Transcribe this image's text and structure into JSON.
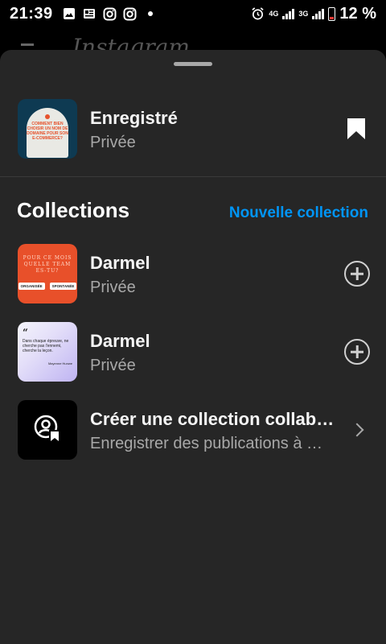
{
  "status_bar": {
    "time": "21:39",
    "left_icons": [
      "image-icon",
      "news-icon",
      "instagram-icon",
      "instagram-icon",
      "dot-icon"
    ],
    "network_4g": "4G",
    "network_3g": "3G",
    "battery_percent": "12 %"
  },
  "background_app": {
    "logo": "Instagram"
  },
  "saved": {
    "title": "Enregistré",
    "subtitle": "Privée",
    "thumb_text": "COMMENT BIEN CHOISIR UN NOM DE DOMAINE POUR SON E-COMMERCE?",
    "icon": "bookmark-icon"
  },
  "collections": {
    "heading": "Collections",
    "new_collection_label": "Nouvelle collection",
    "items": [
      {
        "title": "Darmel",
        "subtitle": "Privée",
        "thumb_title": "POUR CE MOIS QUELLE TEAM ES-TU?",
        "thumb_chip_1": "ORGANISÉE",
        "thumb_chip_2": "SPONTANÉE"
      },
      {
        "title": "Darmel",
        "subtitle": "Privée",
        "thumb_quote": "Dans chaque épreuve, ne cherche pas l'ennemi, cherche la leçon.",
        "thumb_author": "Mayenne Hunwe"
      }
    ],
    "collab": {
      "title": "Créer une collection collab…",
      "subtitle": "Enregistrer des publications à …"
    }
  },
  "colors": {
    "sheet_background": "#262626",
    "accent_blue": "#0095f6",
    "secondary_text": "#a8a8a8"
  }
}
